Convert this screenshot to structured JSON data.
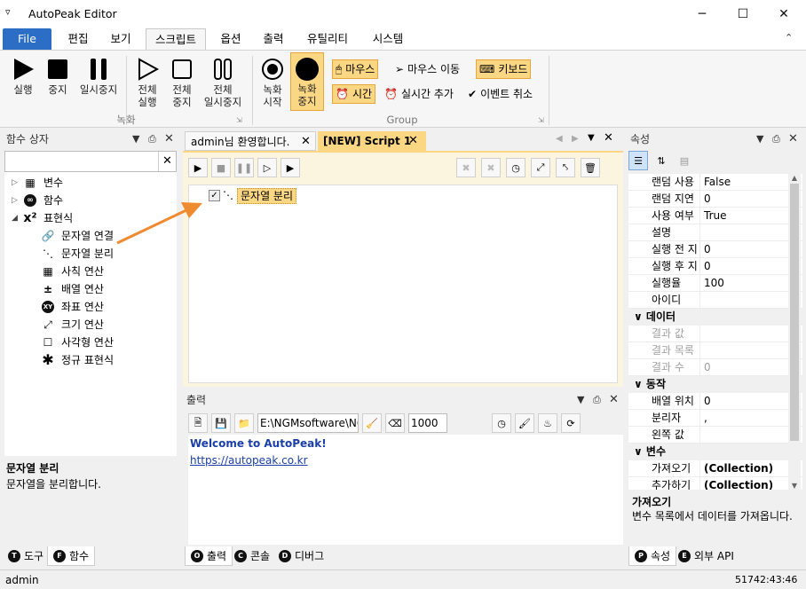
{
  "app": {
    "title": "AutoPeak Editor",
    "menu_icon": "menu-icon"
  },
  "window_controls": {
    "minimize": "─",
    "maximize": "☐",
    "close": "✕"
  },
  "ribbon_tabs": [
    {
      "label": "File"
    },
    {
      "label": "편집"
    },
    {
      "label": "보기"
    },
    {
      "label": "스크립트"
    },
    {
      "label": "옵션"
    },
    {
      "label": "출력"
    },
    {
      "label": "유틸리티"
    },
    {
      "label": "시스템"
    }
  ],
  "ribbon": {
    "run": "실행",
    "stop": "중지",
    "pause": "일시중지",
    "run_all_1": "전체",
    "run_all_2": "실행",
    "stop_all_1": "전체",
    "stop_all_2": "중지",
    "pause_all_1": "전체",
    "pause_all_2": "일시중지",
    "record_group": "녹화",
    "rec_start_1": "녹화",
    "rec_start_2": "시작",
    "rec_stop_1": "녹화",
    "rec_stop_2": "중지",
    "mouse": "마우스",
    "mouse_move": "마우스 이동",
    "keyboard": "키보드",
    "time": "시간",
    "realtime_add": "실시간 추가",
    "event_cancel": "이벤트 취소",
    "group_label": "Group"
  },
  "function_box": {
    "title": "함수 상자",
    "search_value": "",
    "tree": [
      {
        "label": "변수",
        "icon": "variable-icon",
        "level": 0,
        "expander": "▷"
      },
      {
        "label": "함수",
        "icon": "function-icon",
        "level": 0,
        "expander": "▷"
      },
      {
        "label": "표현식",
        "icon": "expression-icon",
        "level": 0,
        "expander": "◢"
      },
      {
        "label": "문자열 연결",
        "icon": "link-icon",
        "level": 1
      },
      {
        "label": "문자열 분리",
        "icon": "unlink-icon",
        "level": 1
      },
      {
        "label": "사칙 연산",
        "icon": "calculator-icon",
        "level": 1
      },
      {
        "label": "배열 연산",
        "icon": "plus-minus-icon",
        "level": 1
      },
      {
        "label": "좌표 연산",
        "icon": "xy-icon",
        "level": 1
      },
      {
        "label": "크기 연산",
        "icon": "resize-icon",
        "level": 1
      },
      {
        "label": "사각형 연산",
        "icon": "rectangle-icon",
        "level": 1
      },
      {
        "label": "정규 표현식",
        "icon": "asterisk-icon",
        "level": 1
      }
    ],
    "desc_title": "문자열 분리",
    "desc_text": "문자열을 분리합니다.",
    "bottom_tabs": [
      {
        "label": "도구",
        "badge": "T"
      },
      {
        "label": "함수",
        "badge": "F"
      }
    ]
  },
  "doc_tabs": [
    {
      "label": "admin님 환영합니다."
    },
    {
      "label": "[NEW] Script 1"
    }
  ],
  "script": {
    "node_label": "문자열 분리",
    "checked": true
  },
  "output": {
    "title": "출력",
    "path": "E:\\NGMsoftware\\NG",
    "count": "1000",
    "lines": [
      "Welcome to AutoPeak!",
      "https://autopeak.co.kr"
    ],
    "bottom_tabs": [
      {
        "label": "출력",
        "badge": "O"
      },
      {
        "label": "콘솔",
        "badge": "C"
      },
      {
        "label": "디버그",
        "badge": "D"
      }
    ]
  },
  "properties": {
    "title": "속성",
    "rows": [
      {
        "type": "row",
        "k": "랜덤 사용",
        "v": "False"
      },
      {
        "type": "row",
        "k": "랜덤 지연",
        "v": "0"
      },
      {
        "type": "row",
        "k": "사용 여부",
        "v": "True"
      },
      {
        "type": "row",
        "k": "설명",
        "v": ""
      },
      {
        "type": "row",
        "k": "실행 전 지",
        "v": "0"
      },
      {
        "type": "row",
        "k": "실행 후 지",
        "v": "0"
      },
      {
        "type": "row",
        "k": "실행율",
        "v": "100"
      },
      {
        "type": "row",
        "k": "아이디",
        "v": ""
      },
      {
        "type": "cat",
        "k": "데이터"
      },
      {
        "type": "dis",
        "k": "결과 값",
        "v": ""
      },
      {
        "type": "dis",
        "k": "결과 목록",
        "v": ""
      },
      {
        "type": "dis",
        "k": "결과 수",
        "v": "0"
      },
      {
        "type": "cat",
        "k": "동작"
      },
      {
        "type": "row",
        "k": "배열 위치",
        "v": "0"
      },
      {
        "type": "row",
        "k": "분리자",
        "v": ","
      },
      {
        "type": "row",
        "k": "왼쪽 값",
        "v": ""
      },
      {
        "type": "cat",
        "k": "변수"
      },
      {
        "type": "row",
        "k": "가져오기",
        "v": "(Collection)",
        "bold": true
      },
      {
        "type": "row",
        "k": "추가하기",
        "v": "(Collection)",
        "bold": true
      }
    ],
    "desc_title": "가져오기",
    "desc_text": "변수 목록에서 데이터를 가져옵니다.",
    "bottom_tabs": [
      {
        "label": "속성",
        "badge": "P"
      },
      {
        "label": "외부 API",
        "badge": "E"
      }
    ]
  },
  "status": {
    "user": "admin",
    "time": "51742:43:46"
  },
  "colors": {
    "accent": "#2c6ec5",
    "highlight": "#fbd784",
    "arrow": "#f08a30"
  }
}
